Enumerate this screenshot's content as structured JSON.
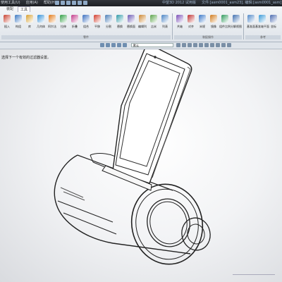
{
  "titlebar": {
    "menu": [
      "使用工具(U)",
      "应用(A)",
      "帮助(H)"
    ],
    "app_title": "中望3D 2012 试用版",
    "file_title": "文件:[asm0001_asm23], 编辑:[asm0001_asm]"
  },
  "ribbon": {
    "tabs": [
      "装配",
      "工具"
    ],
    "active_tab": 1,
    "groups": [
      {
        "label": "零件",
        "buttons": [
          {
            "label": "插入",
            "icon": "insert-part-icon",
            "color": "#c8402e"
          },
          {
            "label": "构组",
            "icon": "component-icon",
            "color": "#3b78c2"
          },
          {
            "label": "库",
            "icon": "library-icon",
            "color": "#d8a02e"
          },
          {
            "label": "几何体",
            "icon": "geometry-icon",
            "color": "#2e8ed8"
          },
          {
            "label": "阿尔法",
            "icon": "alpha-icon",
            "color": "#e27a18"
          },
          {
            "label": "拉伸",
            "icon": "extrude-icon",
            "color": "#2f9e44"
          },
          {
            "label": "折叠",
            "icon": "fold-icon",
            "color": "#c23a8a"
          },
          {
            "label": "组合",
            "icon": "combine-icon",
            "color": "#3a6fc0"
          },
          {
            "label": "平移",
            "icon": "move-icon",
            "color": "#d23c2c"
          },
          {
            "label": "分割",
            "icon": "split-icon",
            "color": "#4c7fb8"
          },
          {
            "label": "替换",
            "icon": "replace-icon",
            "color": "#2e9aa8"
          },
          {
            "label": "替换面",
            "icon": "replace-face-icon",
            "color": "#6a58b4"
          },
          {
            "label": "编辑列",
            "icon": "edit-list-icon",
            "color": "#cc8833"
          },
          {
            "label": "吉米",
            "icon": "gear-part-icon",
            "color": "#5aa44a"
          },
          {
            "label": "列表",
            "icon": "list-icon",
            "color": "#4a84c4"
          }
        ]
      },
      {
        "label": "装配操作",
        "buttons": [
          {
            "label": "共轴",
            "icon": "coaxial-icon",
            "color": "#7b4fb8"
          },
          {
            "label": "对齐",
            "icon": "align-icon",
            "color": "#c03030"
          },
          {
            "label": "米规",
            "icon": "meter-icon",
            "color": "#3a78c8"
          },
          {
            "label": "镜像",
            "icon": "mirror-icon",
            "color": "#d07a1a"
          },
          {
            "label": "组件比例",
            "icon": "scale-icon",
            "color": "#2f9a5c"
          },
          {
            "label": "分解视图",
            "icon": "explode-view-icon",
            "color": "#3f6fb0"
          }
        ]
      },
      {
        "label": "参考",
        "buttons": [
          {
            "label": "基准面",
            "icon": "datum-plane-icon",
            "color": "#5088c8"
          },
          {
            "label": "基准轴平面",
            "icon": "datum-axis-icon",
            "color": "#3a9ad8"
          },
          {
            "label": "坐标",
            "icon": "csys-icon",
            "color": "#4a6ab0"
          }
        ]
      }
    ]
  },
  "toolbar2": {
    "filter_value": "默认"
  },
  "viewport": {
    "prompt": "选择下一个有效的过滤器设置。"
  }
}
